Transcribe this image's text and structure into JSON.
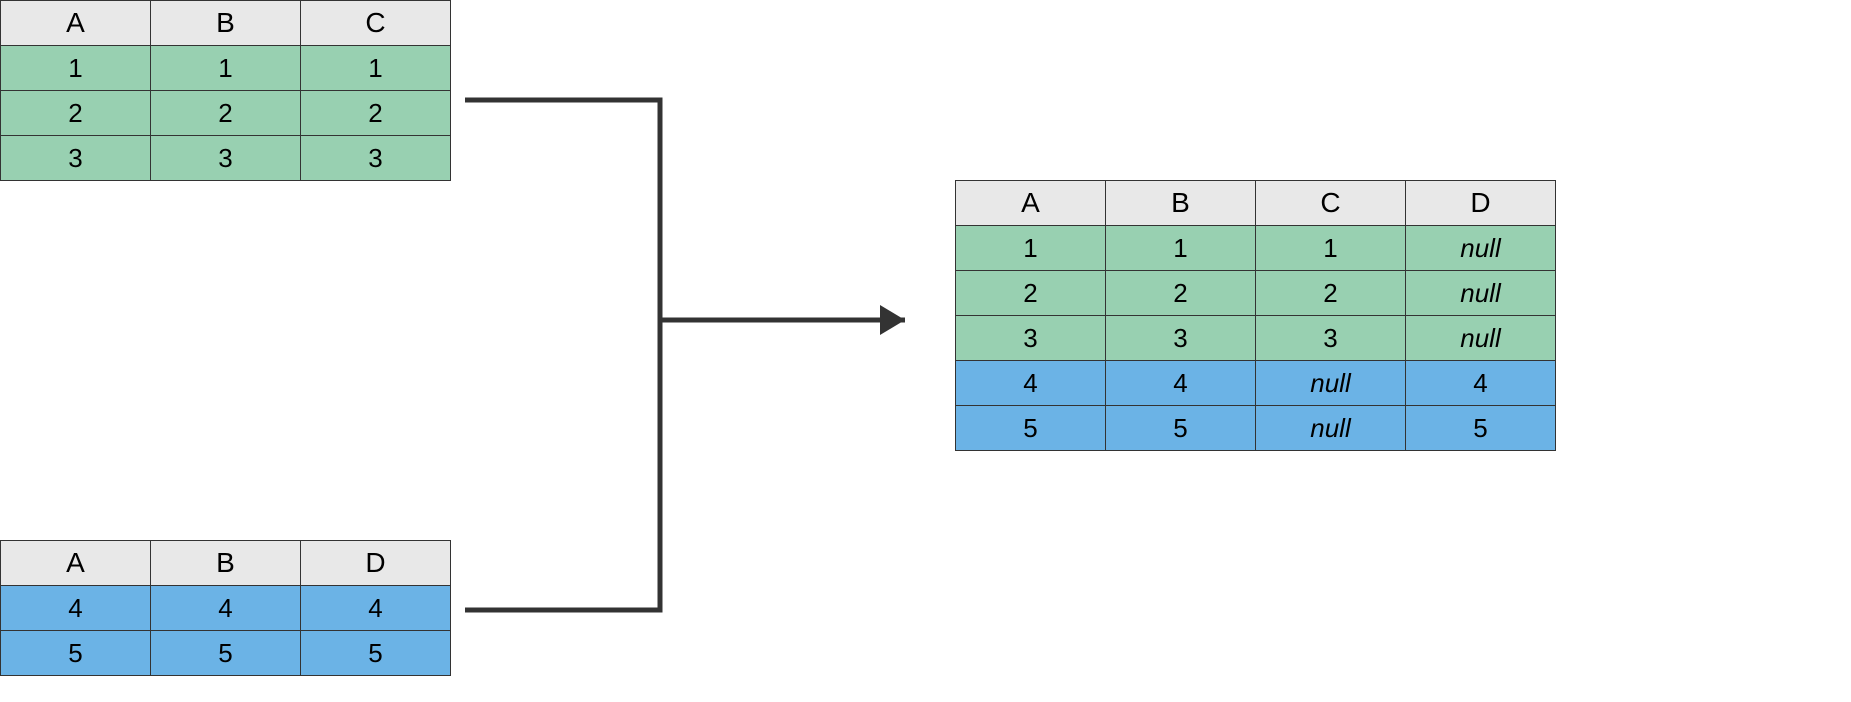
{
  "table1": {
    "headers": [
      "A",
      "B",
      "C"
    ],
    "rows": [
      {
        "cells": [
          "1",
          "1",
          "1"
        ],
        "class": "green"
      },
      {
        "cells": [
          "2",
          "2",
          "2"
        ],
        "class": "green"
      },
      {
        "cells": [
          "3",
          "3",
          "3"
        ],
        "class": "green"
      }
    ]
  },
  "table2": {
    "headers": [
      "A",
      "B",
      "D"
    ],
    "rows": [
      {
        "cells": [
          "4",
          "4",
          "4"
        ],
        "class": "blue"
      },
      {
        "cells": [
          "5",
          "5",
          "5"
        ],
        "class": "blue"
      }
    ]
  },
  "table3": {
    "headers": [
      "A",
      "B",
      "C",
      "D"
    ],
    "rows": [
      {
        "cells": [
          "1",
          "1",
          "1",
          "null"
        ],
        "nullCols": [
          3
        ],
        "class": "green"
      },
      {
        "cells": [
          "2",
          "2",
          "2",
          "null"
        ],
        "nullCols": [
          3
        ],
        "class": "green"
      },
      {
        "cells": [
          "3",
          "3",
          "3",
          "null"
        ],
        "nullCols": [
          3
        ],
        "class": "green"
      },
      {
        "cells": [
          "4",
          "4",
          "null",
          "4"
        ],
        "nullCols": [
          2
        ],
        "class": "blue"
      },
      {
        "cells": [
          "5",
          "5",
          "null",
          "5"
        ],
        "nullCols": [
          2
        ],
        "class": "blue"
      }
    ]
  }
}
